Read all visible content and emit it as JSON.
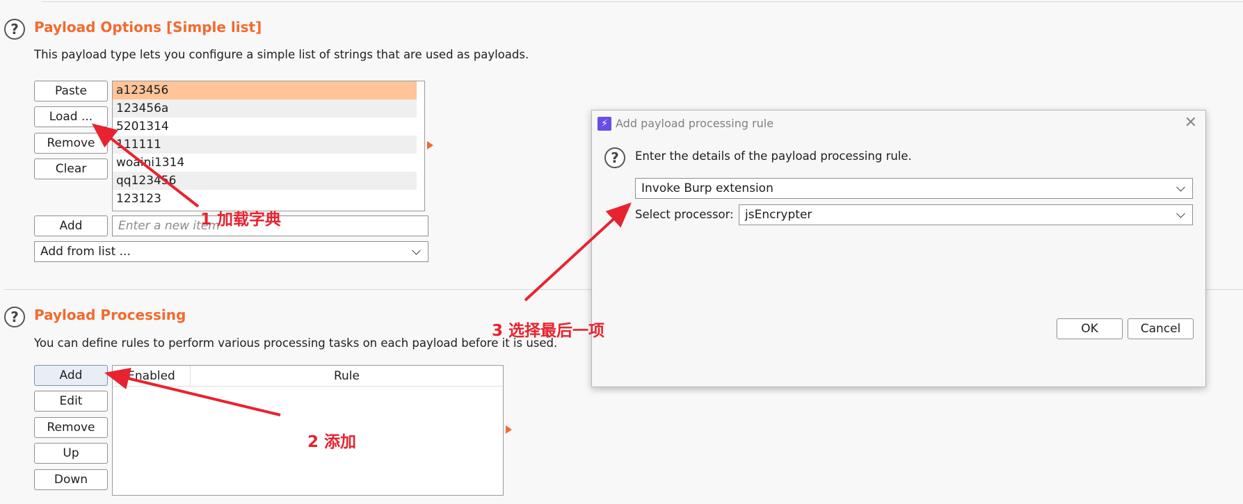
{
  "payload_options": {
    "title": "Payload Options [Simple list]",
    "description": "This payload type lets you configure a simple list of strings that are used as payloads.",
    "buttons": {
      "paste": "Paste",
      "load": "Load ...",
      "remove": "Remove",
      "clear": "Clear",
      "add": "Add"
    },
    "items": [
      "a123456",
      "123456a",
      "5201314",
      "111111",
      "woaini1314",
      "qq123456",
      "123123"
    ],
    "new_item_placeholder": "Enter a new item",
    "add_from_list": "Add from list ..."
  },
  "payload_processing": {
    "title": "Payload Processing",
    "description": "You can define rules to perform various processing tasks on each payload before it is used.",
    "buttons": {
      "add": "Add",
      "edit": "Edit",
      "remove": "Remove",
      "up": "Up",
      "down": "Down"
    },
    "columns": [
      "Enabled",
      "Rule"
    ]
  },
  "dialog": {
    "title": "Add payload processing rule",
    "close": "✕",
    "prompt": "Enter the details of the payload processing rule.",
    "rule_type": "Invoke Burp extension",
    "processor_label": "Select processor:",
    "processor_value": "jsEncrypter",
    "ok": "OK",
    "cancel": "Cancel"
  },
  "annotations": {
    "step1": "1 加载字典",
    "step2": "2 添加",
    "step3": "3 选择最后一项"
  },
  "colors": {
    "accent": "#f26a2e",
    "selection": "#ffc497",
    "annotation": "#e8232f"
  }
}
